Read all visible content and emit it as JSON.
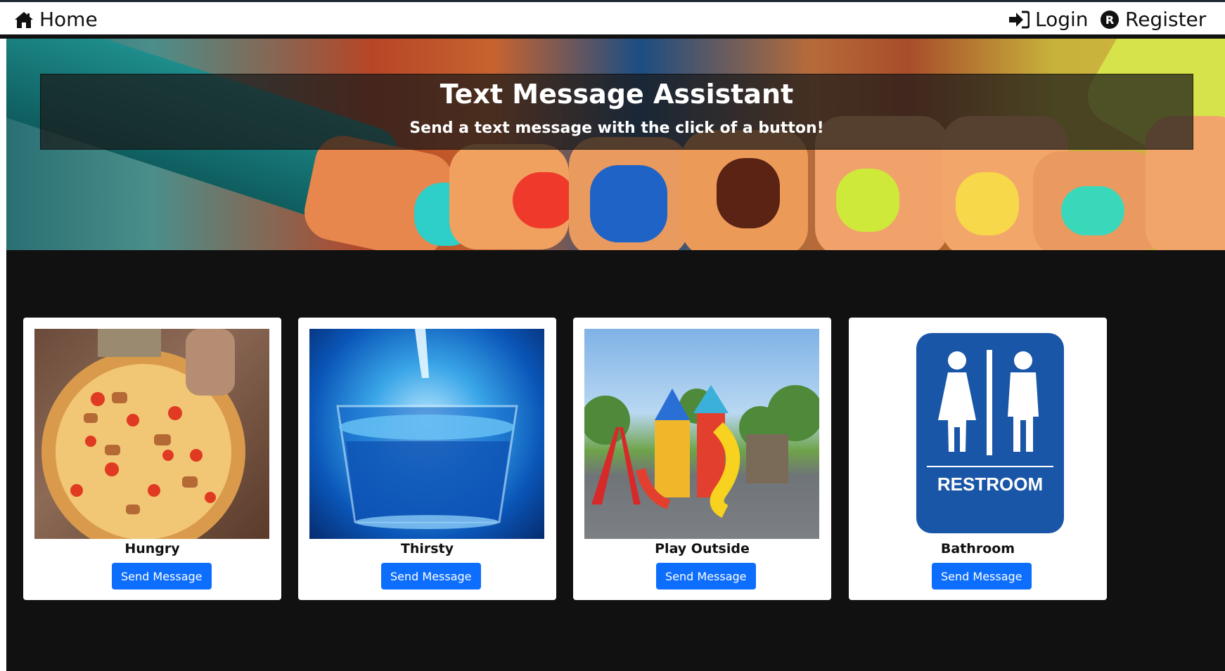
{
  "nav": {
    "home_label": "Home",
    "login_label": "Login",
    "register_label": "Register"
  },
  "hero": {
    "title": "Text Message Assistant",
    "subtitle": "Send a text message with the click of a button!"
  },
  "cards": [
    {
      "label": "Hungry",
      "button_label": "Send Message",
      "image": "pizza-image"
    },
    {
      "label": "Thirsty",
      "button_label": "Send Message",
      "image": "water-glass-image"
    },
    {
      "label": "Play Outside",
      "button_label": "Send Message",
      "image": "playground-image"
    },
    {
      "label": "Bathroom",
      "button_label": "Send Message",
      "image": "restroom-sign-image",
      "sign_text": "RESTROOM"
    }
  ],
  "colors": {
    "button": "#0d6efd",
    "background": "#111111",
    "card": "#ffffff"
  }
}
